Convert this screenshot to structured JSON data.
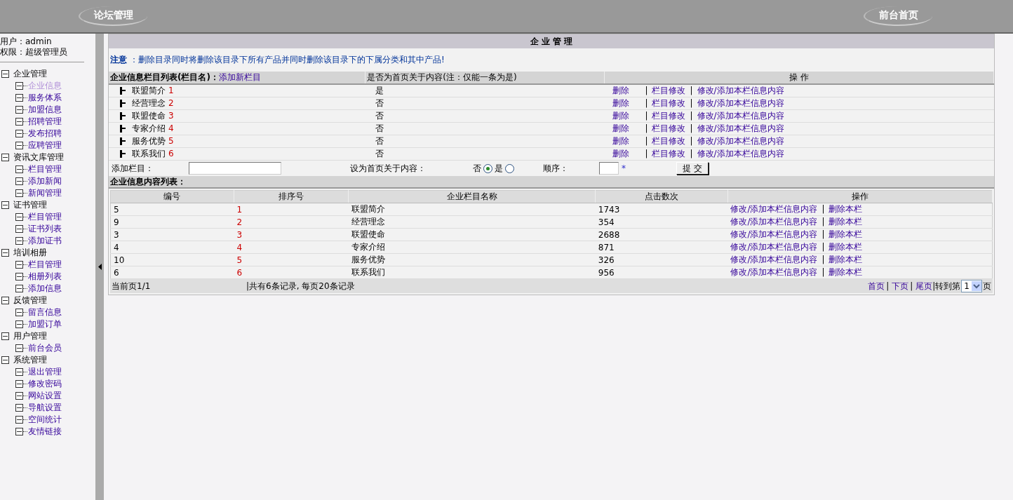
{
  "header": {
    "logo_text": "论坛管理",
    "home_link": "前台首页"
  },
  "sidebar": {
    "user_label": "用户：admin",
    "role_label": "权限：超级管理员",
    "groups": [
      {
        "label": "企业管理",
        "expanded": true,
        "children": [
          {
            "label": "企业信息",
            "selected": true
          },
          {
            "label": "服务体系",
            "selected": false
          },
          {
            "label": "加盟信息",
            "selected": false
          },
          {
            "label": "招聘管理",
            "selected": false
          },
          {
            "label": "发布招聘",
            "selected": false
          },
          {
            "label": "应聘管理",
            "selected": false
          }
        ]
      },
      {
        "label": "资讯文库管理",
        "expanded": true,
        "children": [
          {
            "label": "栏目管理",
            "selected": false
          },
          {
            "label": "添加新闻",
            "selected": false
          },
          {
            "label": "新闻管理",
            "selected": false
          }
        ]
      },
      {
        "label": "证书管理",
        "expanded": true,
        "children": [
          {
            "label": "栏目管理",
            "selected": false
          },
          {
            "label": "证书列表",
            "selected": false
          },
          {
            "label": "添加证书",
            "selected": false
          }
        ]
      },
      {
        "label": "培训相册",
        "expanded": true,
        "children": [
          {
            "label": "栏目管理",
            "selected": false
          },
          {
            "label": "相册列表",
            "selected": false
          },
          {
            "label": "添加信息",
            "selected": false
          }
        ]
      },
      {
        "label": "反馈管理",
        "expanded": true,
        "children": [
          {
            "label": "留言信息",
            "selected": false
          },
          {
            "label": "加盟订单",
            "selected": false
          }
        ]
      },
      {
        "label": "用户管理",
        "expanded": true,
        "children": [
          {
            "label": "前台会员",
            "selected": false
          }
        ]
      },
      {
        "label": "系统管理",
        "expanded": true,
        "children": [
          {
            "label": "退出管理",
            "selected": false
          },
          {
            "label": "修改密码",
            "selected": false
          },
          {
            "label": "网站设置",
            "selected": false
          },
          {
            "label": "导航设置",
            "selected": false
          },
          {
            "label": "空间统计",
            "selected": false
          },
          {
            "label": "友情链接",
            "selected": false
          }
        ]
      }
    ]
  },
  "main": {
    "title": "企 业 管 理",
    "notice": {
      "label": "注意",
      "text": "：删除目录同时将删除该目录下所有产品并同时删除该目录下的下属分类和其中产品!"
    },
    "category_table": {
      "header_title": "企业信息栏目列表(栏目名)：",
      "add_link": "添加新栏目",
      "column_2": "是否为首页关于内容(注：仅能一条为是)",
      "column_3": "操 作",
      "separator": "|",
      "rows": [
        {
          "name": "联盟简介",
          "order": "1",
          "is_home": "是",
          "actions": [
            "删除",
            "栏目修改",
            "修改/添加本栏信息内容"
          ]
        },
        {
          "name": "经营理念",
          "order": "2",
          "is_home": "否",
          "actions": [
            "删除",
            "栏目修改",
            "修改/添加本栏信息内容"
          ]
        },
        {
          "name": "联盟使命",
          "order": "3",
          "is_home": "否",
          "actions": [
            "删除",
            "栏目修改",
            "修改/添加本栏信息内容"
          ]
        },
        {
          "name": "专家介绍",
          "order": "4",
          "is_home": "否",
          "actions": [
            "删除",
            "栏目修改",
            "修改/添加本栏信息内容"
          ]
        },
        {
          "name": "服务优势",
          "order": "5",
          "is_home": "否",
          "actions": [
            "删除",
            "栏目修改",
            "修改/添加本栏信息内容"
          ]
        },
        {
          "name": "联系我们",
          "order": "6",
          "is_home": "否",
          "actions": [
            "删除",
            "栏目修改",
            "修改/添加本栏信息内容"
          ]
        }
      ]
    },
    "add_form": {
      "name_label": "添加栏目：",
      "home_label": "设为首页关于内容：",
      "options": [
        {
          "label": "否",
          "selected": true
        },
        {
          "label": "是",
          "selected": false
        }
      ],
      "order_label": "顺序：",
      "required_mark": "*",
      "submit": "提 交"
    },
    "content_table": {
      "title": "企业信息内容列表：",
      "columns": [
        "编号",
        "排序号",
        "企业栏目名称",
        "点击数次",
        "操作"
      ],
      "separator": "|",
      "rows": [
        {
          "id": "5",
          "order": "1",
          "name": "联盟简介",
          "clicks": "1743",
          "actions": [
            "修改/添加本栏信息内容",
            "删除本栏"
          ]
        },
        {
          "id": "9",
          "order": "2",
          "name": "经营理念",
          "clicks": "354",
          "actions": [
            "修改/添加本栏信息内容",
            "删除本栏"
          ]
        },
        {
          "id": "3",
          "order": "3",
          "name": "联盟使命",
          "clicks": "2688",
          "actions": [
            "修改/添加本栏信息内容",
            "删除本栏"
          ]
        },
        {
          "id": "4",
          "order": "4",
          "name": "专家介绍",
          "clicks": "871",
          "actions": [
            "修改/添加本栏信息内容",
            "删除本栏"
          ]
        },
        {
          "id": "10",
          "order": "5",
          "name": "服务优势",
          "clicks": "326",
          "actions": [
            "修改/添加本栏信息内容",
            "删除本栏"
          ]
        },
        {
          "id": "6",
          "order": "6",
          "name": "联系我们",
          "clicks": "956",
          "actions": [
            "修改/添加本栏信息内容",
            "删除本栏"
          ]
        }
      ],
      "footer": {
        "page_info": "当前页1/1",
        "record_info": "|共有6条记录, 每页20条记录",
        "links": [
          "首页",
          "下页",
          "尾页"
        ],
        "separator": "|",
        "goto_label": "|转到第",
        "page_select": "1",
        "page_suffix": "页"
      }
    }
  }
}
